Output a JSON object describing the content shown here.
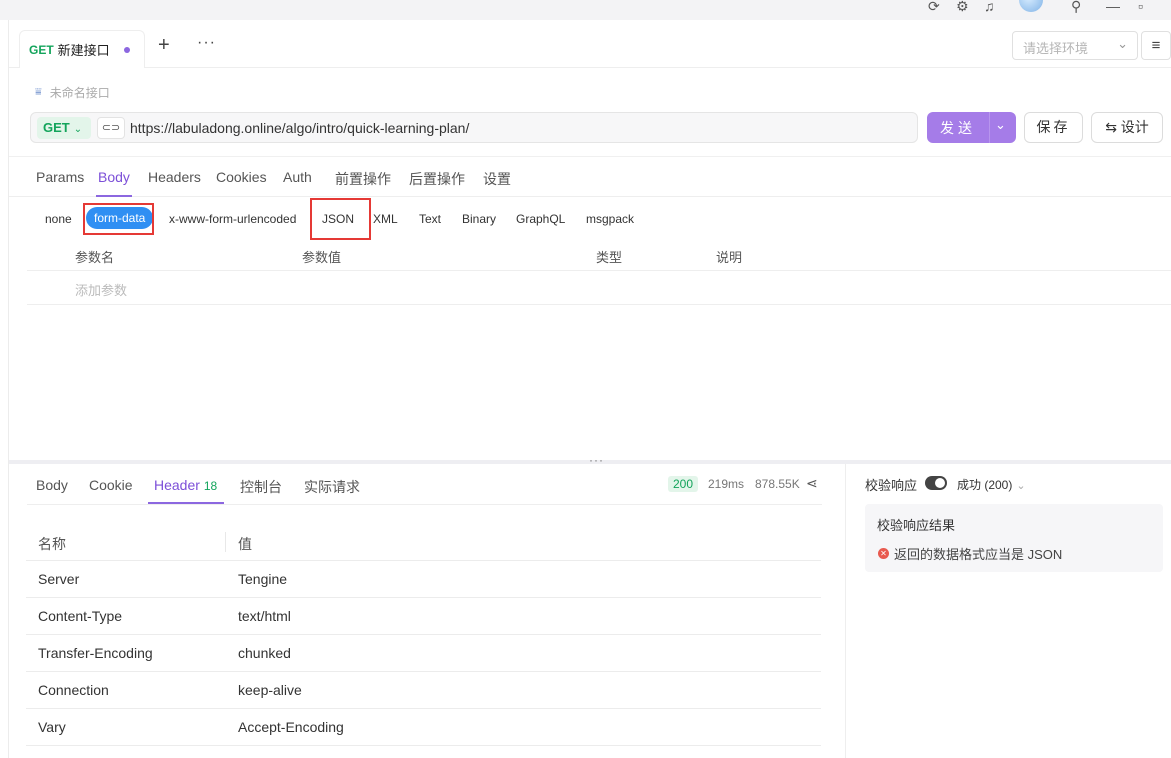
{
  "top_icons": [
    "refresh-icon",
    "settings-icon",
    "bell-icon",
    "pin-icon",
    "minimize-icon",
    "restore-icon"
  ],
  "tab": {
    "method": "GET",
    "title": "新建接口"
  },
  "env_placeholder": "请选择环境",
  "api_name_placeholder": "未命名接口",
  "request": {
    "method": "GET",
    "url": "https://labuladong.online/algo/intro/quick-learning-plan/",
    "send_label": "发送",
    "save_label": "保存",
    "design_label": "⇆ 设计"
  },
  "request_tabs": [
    "Params",
    "Body",
    "Headers",
    "Cookies",
    "Auth",
    "前置操作",
    "后置操作",
    "设置"
  ],
  "active_request_tab": "Body",
  "body_types": [
    "none",
    "form-data",
    "x-www-form-urlencoded",
    "JSON",
    "XML",
    "Text",
    "Binary",
    "GraphQL",
    "msgpack"
  ],
  "active_body_type": "form-data",
  "param_columns": [
    "参数名",
    "参数值",
    "类型",
    "说明"
  ],
  "add_param_placeholder": "添加参数",
  "response_tabs": [
    {
      "label": "Body"
    },
    {
      "label": "Cookie"
    },
    {
      "label": "Header",
      "count": "18"
    },
    {
      "label": "控制台"
    },
    {
      "label": "实际请求"
    }
  ],
  "response_status": {
    "code": "200",
    "time": "219ms",
    "size": "878.55K"
  },
  "header_table": {
    "columns": [
      "名称",
      "值"
    ],
    "rows": [
      [
        "Server",
        "Tengine"
      ],
      [
        "Content-Type",
        "text/html"
      ],
      [
        "Transfer-Encoding",
        "chunked"
      ],
      [
        "Connection",
        "keep-alive"
      ],
      [
        "Vary",
        "Accept-Encoding"
      ]
    ]
  },
  "validation": {
    "label": "校验响应",
    "enabled": true,
    "status_select": "成功 (200)",
    "result_title": "校验响应结果",
    "error_message": "返回的数据格式应当是 JSON"
  },
  "colors": {
    "accent": "#8c67e0",
    "send": "#a57ce8",
    "get": "#13a45b",
    "highlight": "#e53935",
    "chip": "#2f8ff3"
  }
}
